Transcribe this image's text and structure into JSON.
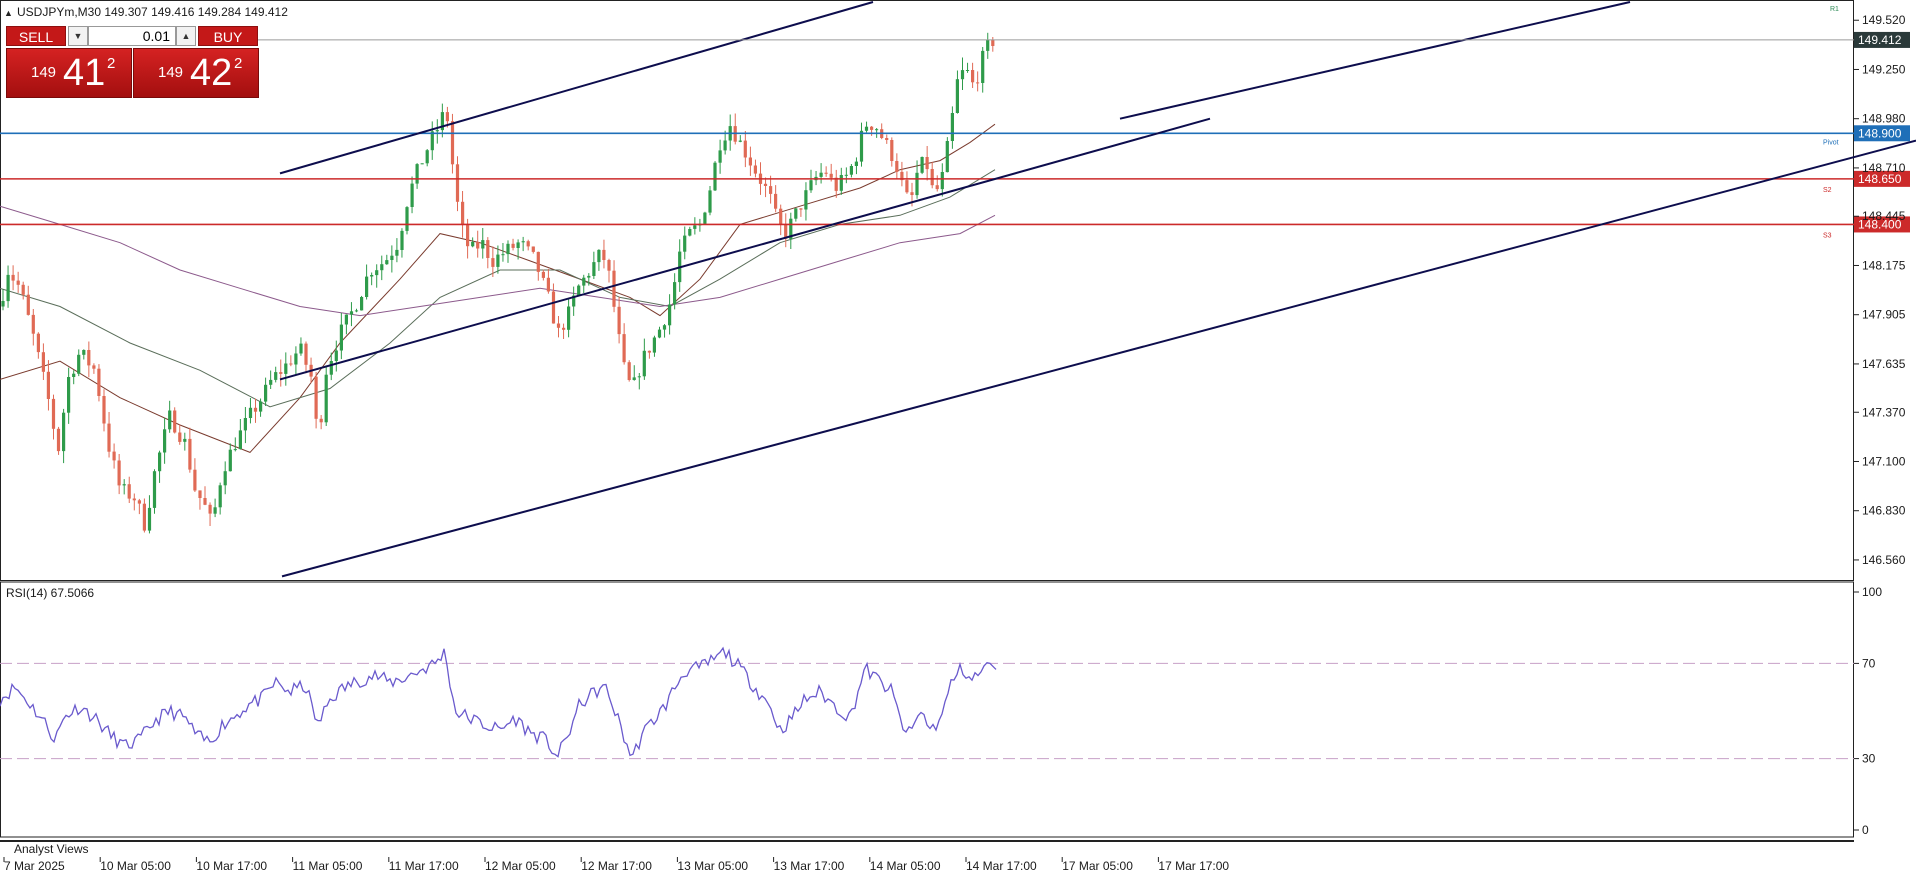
{
  "header": {
    "symbol_line": "USDJPYm,M30  149.307 149.416 149.284 149.412",
    "marker": "▲"
  },
  "trade_panel": {
    "sell_label": "SELL",
    "buy_label": "BUY",
    "lot_value": "0.01",
    "sell_price": {
      "main": "149",
      "big": "41",
      "sup": "2"
    },
    "buy_price": {
      "main": "149",
      "big": "42",
      "sup": "2"
    }
  },
  "chart_data": {
    "type": "candlestick",
    "symbol": "USDJPYm",
    "timeframe": "M30",
    "ohlc_current": {
      "open": 149.307,
      "high": 149.416,
      "low": 149.284,
      "close": 149.412
    },
    "current_price": "149.412",
    "ylim": [
      146.45,
      149.62
    ],
    "y_ticks": [
      "149.520",
      "149.250",
      "148.980",
      "148.710",
      "148.445",
      "148.175",
      "147.905",
      "147.635",
      "147.370",
      "147.100",
      "146.830",
      "146.560"
    ],
    "x_labels": [
      "7 Mar 2025",
      "10 Mar 05:00",
      "10 Mar 17:00",
      "11 Mar 05:00",
      "11 Mar 17:00",
      "12 Mar 05:00",
      "12 Mar 17:00",
      "13 Mar 05:00",
      "13 Mar 17:00",
      "14 Mar 05:00",
      "14 Mar 17:00",
      "17 Mar 05:00",
      "17 Mar 17:00"
    ],
    "levels": [
      {
        "name": "Pivot",
        "value": "148.900",
        "color": "#1f6fb8"
      },
      {
        "name": "S2",
        "value": "148.650",
        "color": "#cc2a2a"
      },
      {
        "name": "S3",
        "value": "148.400",
        "color": "#cc2a2a"
      },
      {
        "name": "R1",
        "value": "",
        "color": "#2e8b57"
      }
    ],
    "path": [
      [
        0,
        147.95
      ],
      [
        8,
        148.15
      ],
      [
        20,
        148.05
      ],
      [
        35,
        147.75
      ],
      [
        50,
        147.4
      ],
      [
        58,
        147.15
      ],
      [
        68,
        147.55
      ],
      [
        80,
        147.7
      ],
      [
        95,
        147.6
      ],
      [
        108,
        147.2
      ],
      [
        120,
        146.95
      ],
      [
        135,
        146.9
      ],
      [
        145,
        146.75
      ],
      [
        155,
        147.05
      ],
      [
        170,
        147.35
      ],
      [
        185,
        147.2
      ],
      [
        195,
        146.95
      ],
      [
        205,
        146.85
      ],
      [
        212,
        146.75
      ],
      [
        222,
        147.05
      ],
      [
        235,
        147.2
      ],
      [
        250,
        147.35
      ],
      [
        262,
        147.45
      ],
      [
        272,
        147.55
      ],
      [
        285,
        147.62
      ],
      [
        300,
        147.72
      ],
      [
        312,
        147.55
      ],
      [
        318,
        147.2
      ],
      [
        326,
        147.6
      ],
      [
        340,
        147.8
      ],
      [
        355,
        147.95
      ],
      [
        370,
        148.15
      ],
      [
        385,
        148.2
      ],
      [
        398,
        148.3
      ],
      [
        408,
        148.55
      ],
      [
        418,
        148.7
      ],
      [
        430,
        148.85
      ],
      [
        440,
        148.95
      ],
      [
        446,
        149.05
      ],
      [
        452,
        148.75
      ],
      [
        460,
        148.4
      ],
      [
        470,
        148.25
      ],
      [
        482,
        148.3
      ],
      [
        492,
        148.2
      ],
      [
        505,
        148.25
      ],
      [
        520,
        148.3
      ],
      [
        535,
        148.2
      ],
      [
        548,
        148.0
      ],
      [
        558,
        147.8
      ],
      [
        568,
        147.9
      ],
      [
        578,
        148.05
      ],
      [
        590,
        148.15
      ],
      [
        602,
        148.25
      ],
      [
        610,
        148.1
      ],
      [
        618,
        147.8
      ],
      [
        626,
        147.55
      ],
      [
        633,
        147.5
      ],
      [
        642,
        147.65
      ],
      [
        652,
        147.75
      ],
      [
        662,
        147.85
      ],
      [
        672,
        148.0
      ],
      [
        680,
        148.25
      ],
      [
        690,
        148.35
      ],
      [
        700,
        148.4
      ],
      [
        710,
        148.6
      ],
      [
        720,
        148.85
      ],
      [
        730,
        148.95
      ],
      [
        740,
        148.85
      ],
      [
        750,
        148.75
      ],
      [
        760,
        148.65
      ],
      [
        770,
        148.55
      ],
      [
        778,
        148.4
      ],
      [
        786,
        148.35
      ],
      [
        795,
        148.45
      ],
      [
        805,
        148.55
      ],
      [
        815,
        148.65
      ],
      [
        825,
        148.7
      ],
      [
        835,
        148.6
      ],
      [
        845,
        148.65
      ],
      [
        855,
        148.75
      ],
      [
        865,
        148.95
      ],
      [
        875,
        148.95
      ],
      [
        885,
        148.85
      ],
      [
        895,
        148.75
      ],
      [
        903,
        148.6
      ],
      [
        910,
        148.5
      ],
      [
        918,
        148.7
      ],
      [
        926,
        148.75
      ],
      [
        934,
        148.55
      ],
      [
        942,
        148.65
      ],
      [
        950,
        148.9
      ],
      [
        958,
        149.2
      ],
      [
        966,
        149.25
      ],
      [
        974,
        149.15
      ],
      [
        982,
        149.3
      ],
      [
        990,
        149.4
      ],
      [
        996,
        149.412
      ]
    ],
    "moving_averages": [
      {
        "color": "#7a3b2e",
        "points": [
          [
            0,
            147.55
          ],
          [
            60,
            147.65
          ],
          [
            120,
            147.45
          ],
          [
            180,
            147.3
          ],
          [
            250,
            147.15
          ],
          [
            300,
            147.45
          ],
          [
            340,
            147.75
          ],
          [
            400,
            148.1
          ],
          [
            440,
            148.35
          ],
          [
            480,
            148.3
          ],
          [
            530,
            148.2
          ],
          [
            580,
            148.1
          ],
          [
            630,
            148.0
          ],
          [
            660,
            147.9
          ],
          [
            700,
            148.1
          ],
          [
            740,
            148.4
          ],
          [
            800,
            148.5
          ],
          [
            860,
            148.6
          ],
          [
            900,
            148.7
          ],
          [
            940,
            148.75
          ],
          [
            970,
            148.85
          ],
          [
            995,
            148.95
          ]
        ]
      },
      {
        "color": "#5a6e5a",
        "points": [
          [
            0,
            148.05
          ],
          [
            60,
            147.95
          ],
          [
            130,
            147.75
          ],
          [
            200,
            147.6
          ],
          [
            270,
            147.4
          ],
          [
            330,
            147.5
          ],
          [
            390,
            147.75
          ],
          [
            440,
            148.0
          ],
          [
            500,
            148.15
          ],
          [
            560,
            148.15
          ],
          [
            620,
            148.0
          ],
          [
            670,
            147.95
          ],
          [
            720,
            148.1
          ],
          [
            780,
            148.3
          ],
          [
            840,
            148.4
          ],
          [
            900,
            148.45
          ],
          [
            950,
            148.55
          ],
          [
            995,
            148.7
          ]
        ]
      },
      {
        "color": "#8c5a8c",
        "points": [
          [
            0,
            148.5
          ],
          [
            60,
            148.4
          ],
          [
            120,
            148.3
          ],
          [
            180,
            148.15
          ],
          [
            240,
            148.05
          ],
          [
            300,
            147.95
          ],
          [
            360,
            147.9
          ],
          [
            420,
            147.95
          ],
          [
            480,
            148.0
          ],
          [
            540,
            148.05
          ],
          [
            600,
            148.0
          ],
          [
            660,
            147.95
          ],
          [
            720,
            148.0
          ],
          [
            780,
            148.1
          ],
          [
            840,
            148.2
          ],
          [
            900,
            148.3
          ],
          [
            960,
            148.35
          ],
          [
            995,
            148.45
          ]
        ]
      }
    ],
    "trendlines": [
      {
        "from": [
          282,
          146.47
        ],
        "to": [
          1916,
          148.86
        ]
      },
      {
        "from": [
          280,
          147.55
        ],
        "to": [
          1210,
          148.98
        ]
      },
      {
        "from": [
          280,
          148.68
        ],
        "to": [
          873,
          149.62
        ]
      },
      {
        "from": [
          1120,
          148.98
        ],
        "to": [
          1630,
          149.62
        ]
      }
    ]
  },
  "rsi_panel": {
    "label": "RSI(14) 67.5066",
    "period": 14,
    "value": 67.5066,
    "ylim": [
      0,
      100
    ],
    "ticks": [
      "100",
      "70",
      "30",
      "0"
    ],
    "levels": [
      70,
      30
    ],
    "color": "#6a5acd",
    "path": [
      [
        0,
        55
      ],
      [
        15,
        60
      ],
      [
        30,
        53
      ],
      [
        45,
        45
      ],
      [
        55,
        38
      ],
      [
        65,
        48
      ],
      [
        80,
        52
      ],
      [
        95,
        47
      ],
      [
        110,
        40
      ],
      [
        125,
        35
      ],
      [
        140,
        38
      ],
      [
        155,
        46
      ],
      [
        170,
        50
      ],
      [
        185,
        47
      ],
      [
        198,
        39
      ],
      [
        210,
        37
      ],
      [
        222,
        44
      ],
      [
        235,
        48
      ],
      [
        250,
        53
      ],
      [
        262,
        55
      ],
      [
        275,
        62
      ],
      [
        290,
        58
      ],
      [
        305,
        61
      ],
      [
        318,
        44
      ],
      [
        330,
        55
      ],
      [
        345,
        60
      ],
      [
        360,
        63
      ],
      [
        375,
        65
      ],
      [
        390,
        62
      ],
      [
        405,
        64
      ],
      [
        420,
        67
      ],
      [
        435,
        70
      ],
      [
        445,
        75
      ],
      [
        455,
        50
      ],
      [
        470,
        47
      ],
      [
        485,
        44
      ],
      [
        500,
        42
      ],
      [
        515,
        47
      ],
      [
        530,
        41
      ],
      [
        545,
        38
      ],
      [
        558,
        31
      ],
      [
        568,
        40
      ],
      [
        580,
        53
      ],
      [
        595,
        58
      ],
      [
        605,
        60
      ],
      [
        615,
        50
      ],
      [
        625,
        38
      ],
      [
        632,
        30
      ],
      [
        642,
        40
      ],
      [
        655,
        47
      ],
      [
        665,
        52
      ],
      [
        675,
        60
      ],
      [
        685,
        67
      ],
      [
        700,
        68
      ],
      [
        715,
        72
      ],
      [
        725,
        75
      ],
      [
        740,
        68
      ],
      [
        755,
        60
      ],
      [
        770,
        52
      ],
      [
        780,
        42
      ],
      [
        790,
        46
      ],
      [
        805,
        55
      ],
      [
        820,
        58
      ],
      [
        835,
        52
      ],
      [
        850,
        47
      ],
      [
        865,
        68
      ],
      [
        878,
        63
      ],
      [
        892,
        58
      ],
      [
        902,
        44
      ],
      [
        910,
        40
      ],
      [
        920,
        50
      ],
      [
        932,
        42
      ],
      [
        942,
        48
      ],
      [
        952,
        63
      ],
      [
        962,
        68
      ],
      [
        972,
        63
      ],
      [
        982,
        67
      ],
      [
        990,
        70
      ],
      [
        996,
        67.5
      ]
    ]
  },
  "analyst_views_label": "Analyst Views"
}
